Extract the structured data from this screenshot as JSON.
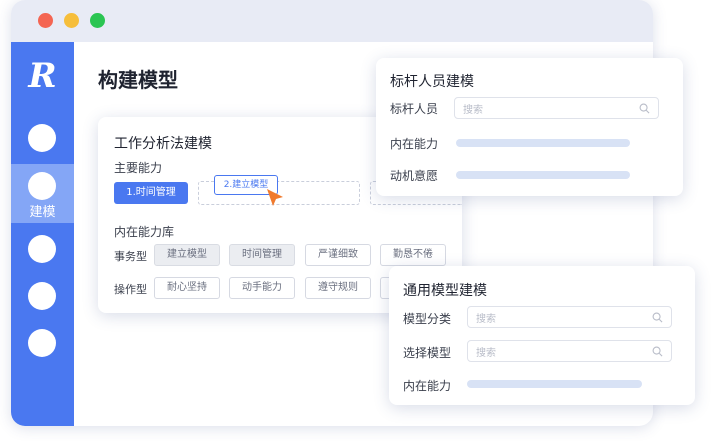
{
  "sidebar": {
    "logo": "R",
    "active_label": "建模"
  },
  "main": {
    "page_title": "构建模型"
  },
  "work_card": {
    "title": "工作分析法建模",
    "main_ability_label": "主要能力",
    "selected_chip": "1.时间管理",
    "drag_chip": "2.建立模型",
    "library_label": "内在能力库",
    "rows": [
      {
        "label": "事务型",
        "chips": [
          "建立模型",
          "时间管理",
          "严谨细致",
          "勤恳不倦"
        ]
      },
      {
        "label": "操作型",
        "chips": [
          "耐心坚持",
          "动手能力",
          "遵守规则",
          ""
        ]
      }
    ]
  },
  "benchmark_card": {
    "title": "标杆人员建模",
    "fields": [
      {
        "label": "标杆人员",
        "placeholder": "搜索"
      },
      {
        "label": "内在能力"
      },
      {
        "label": "动机意愿"
      }
    ]
  },
  "general_card": {
    "title": "通用模型建模",
    "fields": [
      {
        "label": "模型分类",
        "placeholder": "搜索"
      },
      {
        "label": "选择模型",
        "placeholder": "搜索"
      },
      {
        "label": "内在能力"
      }
    ]
  },
  "colors": {
    "accent": "#4a78f0",
    "accent_light": "#84a6f6",
    "bar": "#d8e2f5"
  }
}
